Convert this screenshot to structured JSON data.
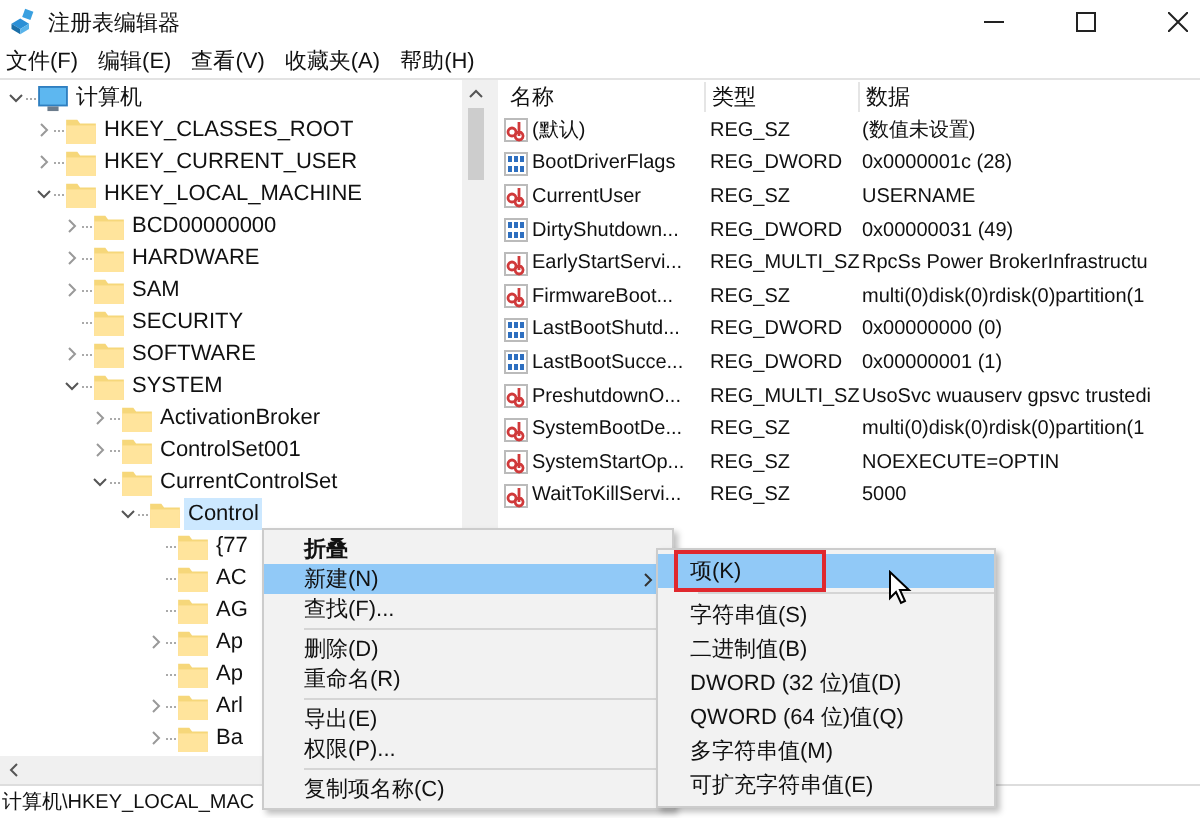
{
  "window": {
    "title": "注册表编辑器"
  },
  "menu_bar": [
    "文件(F)",
    "编辑(E)",
    "查看(V)",
    "收藏夹(A)",
    "帮助(H)"
  ],
  "tree": [
    {
      "label": "计算机",
      "kind": "computer",
      "expandable": true,
      "expanded": true,
      "selected": false,
      "children": [
        {
          "label": "HKEY_CLASSES_ROOT",
          "kind": "folder",
          "expandable": true,
          "expanded": false,
          "selected": false
        },
        {
          "label": "HKEY_CURRENT_USER",
          "kind": "folder",
          "expandable": true,
          "expanded": false,
          "selected": false
        },
        {
          "label": "HKEY_LOCAL_MACHINE",
          "kind": "folder",
          "expandable": true,
          "expanded": true,
          "selected": false,
          "children": [
            {
              "label": "BCD00000000",
              "kind": "folder",
              "expandable": true,
              "expanded": false,
              "selected": false
            },
            {
              "label": "HARDWARE",
              "kind": "folder",
              "expandable": true,
              "expanded": false,
              "selected": false
            },
            {
              "label": "SAM",
              "kind": "folder",
              "expandable": true,
              "expanded": false,
              "selected": false
            },
            {
              "label": "SECURITY",
              "kind": "folder",
              "expandable": false,
              "selected": false
            },
            {
              "label": "SOFTWARE",
              "kind": "folder",
              "expandable": true,
              "expanded": false,
              "selected": false
            },
            {
              "label": "SYSTEM",
              "kind": "folder",
              "expandable": true,
              "expanded": true,
              "selected": false,
              "children": [
                {
                  "label": "ActivationBroker",
                  "kind": "folder",
                  "expandable": true,
                  "expanded": false,
                  "selected": false
                },
                {
                  "label": "ControlSet001",
                  "kind": "folder",
                  "expandable": true,
                  "expanded": false,
                  "selected": false
                },
                {
                  "label": "CurrentControlSet",
                  "kind": "folder",
                  "expandable": true,
                  "expanded": true,
                  "selected": false,
                  "children": [
                    {
                      "label": "Control",
                      "kind": "folder",
                      "expandable": true,
                      "expanded": true,
                      "selected": true,
                      "children": [
                        {
                          "label": "{77",
                          "kind": "folder",
                          "expandable": false,
                          "selected": false
                        },
                        {
                          "label": "AC",
                          "kind": "folder",
                          "expandable": false,
                          "selected": false
                        },
                        {
                          "label": "AG",
                          "kind": "folder",
                          "expandable": false,
                          "selected": false
                        },
                        {
                          "label": "Ap",
                          "kind": "folder",
                          "expandable": true,
                          "expanded": false,
                          "selected": false
                        },
                        {
                          "label": "Ap",
                          "kind": "folder",
                          "expandable": false,
                          "selected": false
                        },
                        {
                          "label": "Arl",
                          "kind": "folder",
                          "expandable": true,
                          "expanded": false,
                          "selected": false
                        },
                        {
                          "label": "Ba",
                          "kind": "folder",
                          "expandable": true,
                          "expanded": false,
                          "selected": false
                        }
                      ]
                    }
                  ]
                }
              ]
            }
          ]
        }
      ]
    }
  ],
  "values": {
    "columns": [
      "名称",
      "类型",
      "数据"
    ],
    "rows": [
      {
        "kind": "string",
        "name": "(默认)",
        "type": "REG_SZ",
        "data": "(数值未设置)"
      },
      {
        "kind": "binary",
        "name": "BootDriverFlags",
        "type": "REG_DWORD",
        "data": "0x0000001c (28)"
      },
      {
        "kind": "string",
        "name": "CurrentUser",
        "type": "REG_SZ",
        "data": "USERNAME"
      },
      {
        "kind": "binary",
        "name": "DirtyShutdown...",
        "type": "REG_DWORD",
        "data": "0x00000031 (49)"
      },
      {
        "kind": "string",
        "name": "EarlyStartServi...",
        "type": "REG_MULTI_SZ",
        "data": "RpcSs Power BrokerInfrastructu"
      },
      {
        "kind": "string",
        "name": "FirmwareBoot...",
        "type": "REG_SZ",
        "data": "multi(0)disk(0)rdisk(0)partition(1"
      },
      {
        "kind": "binary",
        "name": "LastBootShutd...",
        "type": "REG_DWORD",
        "data": "0x00000000 (0)"
      },
      {
        "kind": "binary",
        "name": "LastBootSucce...",
        "type": "REG_DWORD",
        "data": "0x00000001 (1)"
      },
      {
        "kind": "string",
        "name": "PreshutdownO...",
        "type": "REG_MULTI_SZ",
        "data": "UsoSvc wuauserv gpsvc trustedi"
      },
      {
        "kind": "string",
        "name": "SystemBootDe...",
        "type": "REG_SZ",
        "data": "multi(0)disk(0)rdisk(0)partition(1"
      },
      {
        "kind": "string",
        "name": "SystemStartOp...",
        "type": "REG_SZ",
        "data": "NOEXECUTE=OPTIN"
      },
      {
        "kind": "string",
        "name": "WaitToKillServi...",
        "type": "REG_SZ",
        "data": "5000"
      }
    ]
  },
  "status_bar": "计算机\\HKEY_LOCAL_MAC",
  "context_menu": [
    {
      "kind": "item",
      "label": "折叠",
      "bold": true,
      "submenu": false,
      "selected": false
    },
    {
      "kind": "item",
      "label": "新建(N)",
      "bold": false,
      "submenu": true,
      "selected": true
    },
    {
      "kind": "item",
      "label": "查找(F)...",
      "bold": false,
      "submenu": false,
      "selected": false
    },
    {
      "kind": "separator"
    },
    {
      "kind": "item",
      "label": "删除(D)",
      "bold": false,
      "submenu": false,
      "selected": false
    },
    {
      "kind": "item",
      "label": "重命名(R)",
      "bold": false,
      "submenu": false,
      "selected": false
    },
    {
      "kind": "separator"
    },
    {
      "kind": "item",
      "label": "导出(E)",
      "bold": false,
      "submenu": false,
      "selected": false
    },
    {
      "kind": "item",
      "label": "权限(P)...",
      "bold": false,
      "submenu": false,
      "selected": false
    },
    {
      "kind": "separator"
    },
    {
      "kind": "item",
      "label": "复制项名称(C)",
      "bold": false,
      "submenu": false,
      "selected": false
    }
  ],
  "submenu": [
    {
      "kind": "item",
      "label": "项(K)",
      "selected": true,
      "outlined": true
    },
    {
      "kind": "separator"
    },
    {
      "kind": "item",
      "label": "字符串值(S)",
      "selected": false,
      "outlined": false
    },
    {
      "kind": "item",
      "label": "二进制值(B)",
      "selected": false,
      "outlined": false
    },
    {
      "kind": "item",
      "label": "DWORD (32 位)值(D)",
      "selected": false,
      "outlined": false
    },
    {
      "kind": "item",
      "label": "QWORD (64 位)值(Q)",
      "selected": false,
      "outlined": false
    },
    {
      "kind": "item",
      "label": "多字符串值(M)",
      "selected": false,
      "outlined": false
    },
    {
      "kind": "item",
      "label": "可扩充字符串值(E)",
      "selected": false,
      "outlined": false
    }
  ]
}
